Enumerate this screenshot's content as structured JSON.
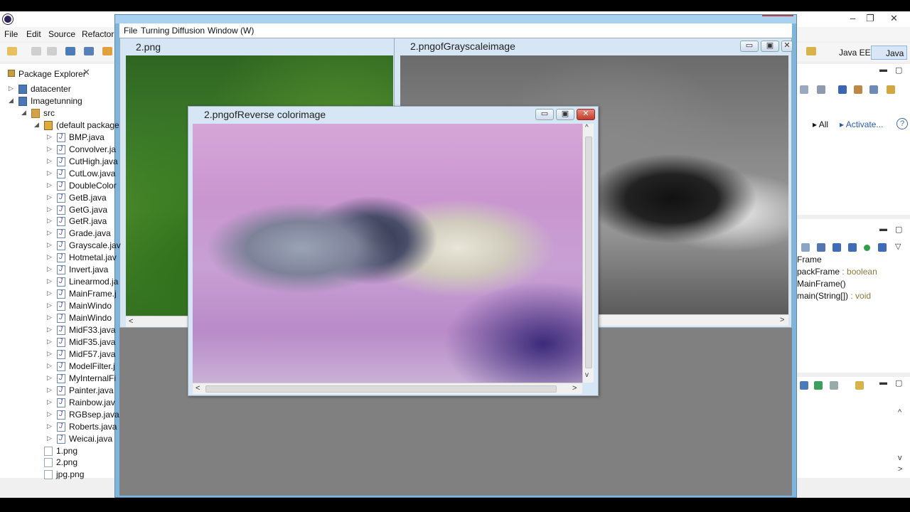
{
  "eclipse": {
    "menu": [
      "File",
      "Edit",
      "Source",
      "Refactor"
    ],
    "perspectives": [
      "Java EE",
      "Java"
    ],
    "window_controls": [
      "–",
      "❐",
      "✕"
    ],
    "package_explorer": {
      "title": "Package Explorer",
      "close": "✕",
      "tree": [
        {
          "label": "datacenter",
          "type": "proj",
          "level": 0,
          "arrow": "▷"
        },
        {
          "label": "Imagetunning",
          "type": "proj",
          "level": 0,
          "arrow": "◢"
        },
        {
          "label": "src",
          "type": "src",
          "level": 1,
          "arrow": "◢"
        },
        {
          "label": "(default package",
          "type": "pkg",
          "level": 2,
          "arrow": "◢"
        },
        {
          "label": "BMP.java",
          "type": "java",
          "level": 3,
          "arrow": "▷"
        },
        {
          "label": "Convolver.ja",
          "type": "java",
          "level": 3,
          "arrow": "▷"
        },
        {
          "label": "CutHigh.java",
          "type": "java",
          "level": 3,
          "arrow": "▷"
        },
        {
          "label": "CutLow.java",
          "type": "java",
          "level": 3,
          "arrow": "▷"
        },
        {
          "label": "DoubleColor",
          "type": "java",
          "level": 3,
          "arrow": "▷"
        },
        {
          "label": "GetB.java",
          "type": "java",
          "level": 3,
          "arrow": "▷"
        },
        {
          "label": "GetG.java",
          "type": "java",
          "level": 3,
          "arrow": "▷"
        },
        {
          "label": "GetR.java",
          "type": "java",
          "level": 3,
          "arrow": "▷"
        },
        {
          "label": "Grade.java",
          "type": "java",
          "level": 3,
          "arrow": "▷"
        },
        {
          "label": "Grayscale.jav",
          "type": "java",
          "level": 3,
          "arrow": "▷"
        },
        {
          "label": "Hotmetal.jav",
          "type": "java",
          "level": 3,
          "arrow": "▷"
        },
        {
          "label": "Invert.java",
          "type": "java",
          "level": 3,
          "arrow": "▷"
        },
        {
          "label": "Linearmod.ja",
          "type": "java",
          "level": 3,
          "arrow": "▷"
        },
        {
          "label": "MainFrame.j",
          "type": "java",
          "level": 3,
          "arrow": "▷"
        },
        {
          "label": "MainWindo",
          "type": "java",
          "level": 3,
          "arrow": "▷"
        },
        {
          "label": "MainWindo",
          "type": "java",
          "level": 3,
          "arrow": "▷"
        },
        {
          "label": "MidF33.java",
          "type": "java",
          "level": 3,
          "arrow": "▷"
        },
        {
          "label": "MidF35.java",
          "type": "java",
          "level": 3,
          "arrow": "▷"
        },
        {
          "label": "MidF57.java",
          "type": "java",
          "level": 3,
          "arrow": "▷"
        },
        {
          "label": "ModelFilter.j",
          "type": "java",
          "level": 3,
          "arrow": "▷"
        },
        {
          "label": "MyInternalFi",
          "type": "java",
          "level": 3,
          "arrow": "▷"
        },
        {
          "label": "Painter.java",
          "type": "java",
          "level": 3,
          "arrow": "▷"
        },
        {
          "label": "Rainbow.jav",
          "type": "java",
          "level": 3,
          "arrow": "▷"
        },
        {
          "label": "RGBsep.java",
          "type": "java",
          "level": 3,
          "arrow": "▷"
        },
        {
          "label": "Roberts.java",
          "type": "java",
          "level": 3,
          "arrow": "▷"
        },
        {
          "label": "Weicai.java",
          "type": "java",
          "level": 3,
          "arrow": "▷"
        },
        {
          "label": "1.png",
          "type": "png",
          "level": 2,
          "arrow": ""
        },
        {
          "label": "2.png",
          "type": "png",
          "level": 2,
          "arrow": ""
        },
        {
          "label": "jpg.png",
          "type": "png",
          "level": 2,
          "arrow": ""
        }
      ]
    },
    "task_panel": {
      "all": "All",
      "activate": "Activate...",
      "help": "?"
    },
    "outline": {
      "items": [
        {
          "name": "Frame",
          "type": ""
        },
        {
          "name": "packFrame",
          "type": " : boolean"
        },
        {
          "name": "MainFrame()",
          "type": ""
        },
        {
          "name": "main(String[])",
          "type": " : void"
        }
      ]
    }
  },
  "app": {
    "menu": [
      "File",
      "Turning Diffusion",
      "Window (W)"
    ],
    "frames": {
      "original": {
        "title": "2.png"
      },
      "grayscale": {
        "title": "2.pngofGrayscaleimage"
      },
      "reverse": {
        "title": "2.pngofReverse colorimage"
      }
    },
    "buttons": {
      "minimize": "▭",
      "maximize": "▣",
      "close": "✕"
    },
    "scroll": {
      "left": "<",
      "right": ">",
      "up": "^",
      "down": "v"
    }
  }
}
